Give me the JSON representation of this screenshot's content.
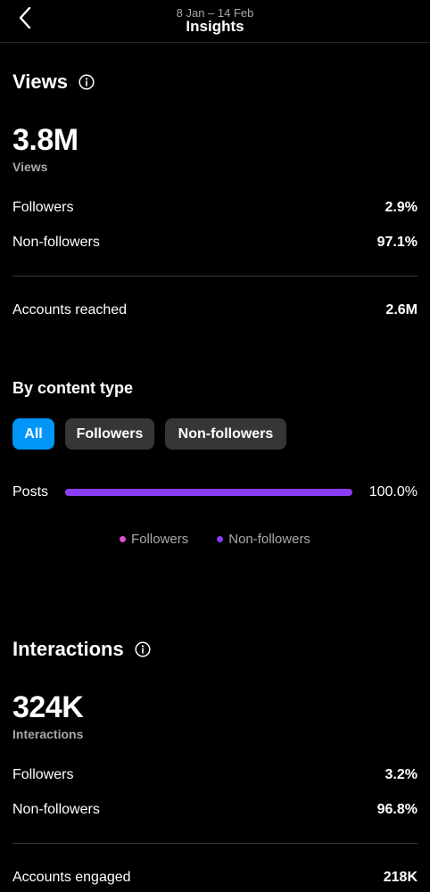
{
  "header": {
    "date_range": "8 Jan – 14 Feb",
    "title": "Insights"
  },
  "views": {
    "title": "Views",
    "total": "3.8M",
    "total_label": "Views",
    "followers_label": "Followers",
    "followers_value": "2.9%",
    "non_followers_label": "Non-followers",
    "non_followers_value": "97.1%",
    "accounts_label": "Accounts reached",
    "accounts_value": "2.6M"
  },
  "content_type": {
    "title": "By content type",
    "filters": [
      "All",
      "Followers",
      "Non-followers"
    ],
    "active_filter": "All",
    "row_label": "Posts",
    "row_value": "100.0%",
    "followers_share": 0.002,
    "non_followers_share": 0.998,
    "legend": [
      "Followers",
      "Non-followers"
    ]
  },
  "interactions": {
    "title": "Interactions",
    "total": "324K",
    "total_label": "Interactions",
    "followers_label": "Followers",
    "followers_value": "3.2%",
    "non_followers_label": "Non-followers",
    "non_followers_value": "96.8%",
    "accounts_label": "Accounts engaged",
    "accounts_value": "218K"
  },
  "colors": {
    "accent": "#0095f6",
    "followers": "#e14bcf",
    "non_followers": "#8a3df5",
    "muted_text": "#a8a8a8"
  }
}
